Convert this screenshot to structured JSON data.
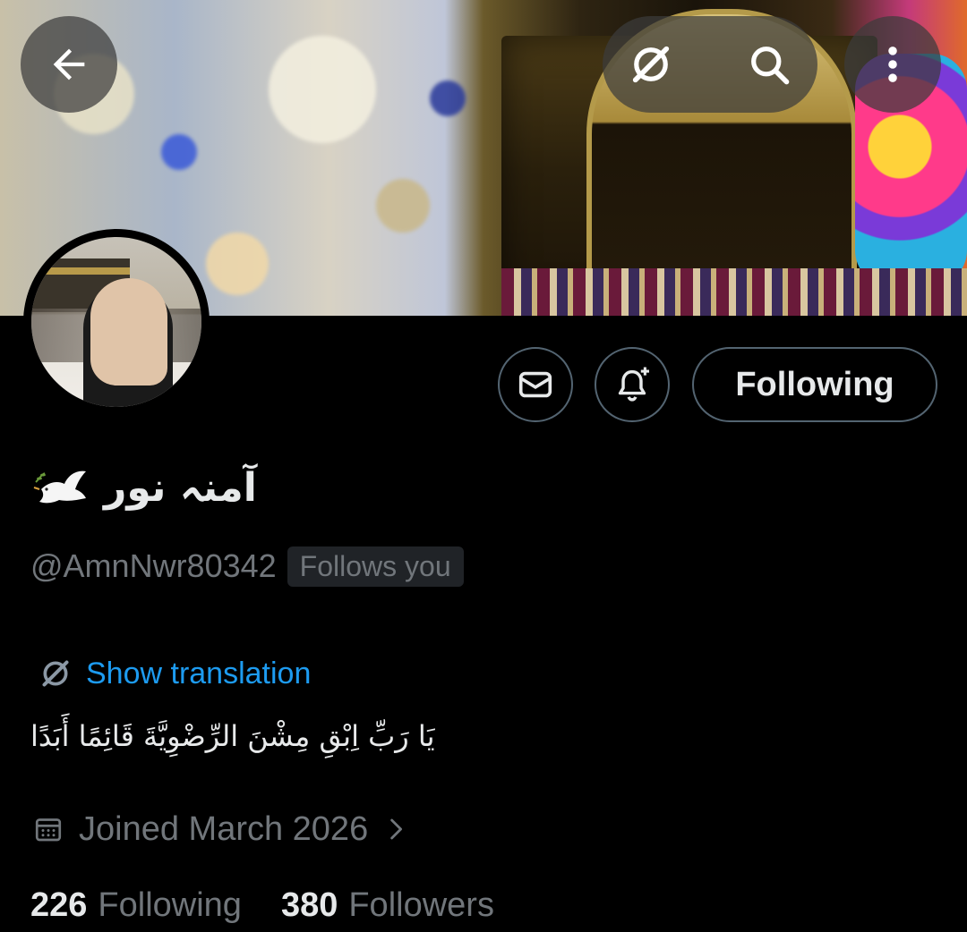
{
  "header": {
    "back_icon": "arrow-left-icon",
    "grok_icon": "grok-icon",
    "search_icon": "search-icon",
    "more_icon": "more-vertical-icon"
  },
  "actions": {
    "message_icon": "mail-icon",
    "notify_icon": "bell-plus-icon",
    "following_label": "Following"
  },
  "profile": {
    "display_name": "آمنہ نور",
    "name_emoji": "dove-icon",
    "handle": "@AmnNwr80342",
    "follows_you": "Follows you",
    "show_translation": "Show translation",
    "bio": "يَا رَبِّ اِبْقِ مِشْنَ الرِّضْوِيَّةَ قَائِمًا أَبَدًا",
    "joined": "Joined March 2026",
    "following_count": "226",
    "following_label": "Following",
    "followers_count": "380",
    "followers_label": "Followers"
  },
  "colors": {
    "background": "#000000",
    "text_primary": "#e7e9ea",
    "text_secondary": "#71767b",
    "accent": "#1d9bf0",
    "border": "#536471"
  }
}
